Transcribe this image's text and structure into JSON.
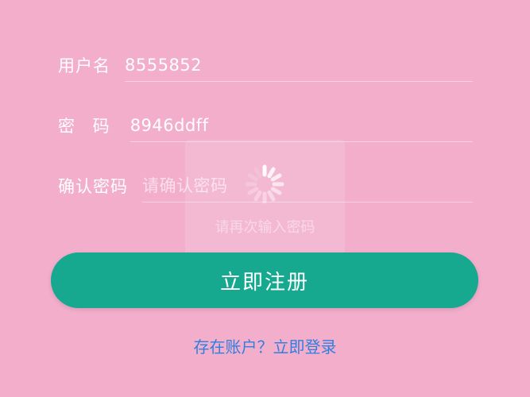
{
  "form": {
    "username": {
      "label": "用户名",
      "value": "8555852",
      "placeholder": ""
    },
    "password": {
      "label": "密 码",
      "value": "8946ddff",
      "placeholder": ""
    },
    "confirm_password": {
      "label": "确认密码",
      "value": "",
      "placeholder": "请确认密码"
    }
  },
  "toast": {
    "icon": "spinner-icon",
    "text": "请再次输入密码"
  },
  "register_button": {
    "label": "立即注册"
  },
  "login_link": {
    "label": "存在账户？立即登录"
  },
  "colors": {
    "background": "#f3aecb",
    "button": "#17a98f",
    "link": "#2f7fe0"
  }
}
